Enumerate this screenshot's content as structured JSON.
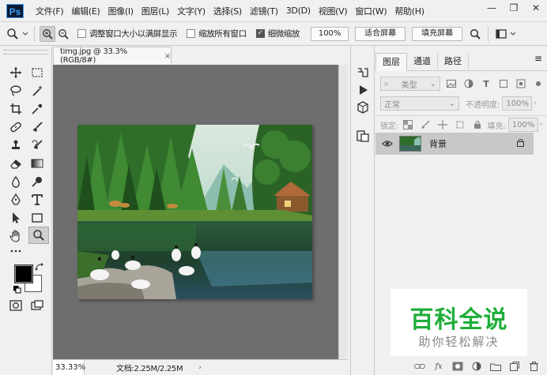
{
  "app": {
    "logo": "Ps"
  },
  "menu": [
    "文件(F)",
    "编辑(E)",
    "图像(I)",
    "图层(L)",
    "文字(Y)",
    "选择(S)",
    "滤镜(T)",
    "3D(D)",
    "视图(V)",
    "窗口(W)",
    "帮助(H)"
  ],
  "window_controls": {
    "minimize": "—",
    "restore": "❐",
    "close": "✕"
  },
  "options": {
    "resize_windows": {
      "label": "调整窗口大小以满屏显示",
      "checked": false
    },
    "zoom_all": {
      "label": "缩放所有窗口",
      "checked": false
    },
    "scrubby_zoom": {
      "label": "细微缩放",
      "checked": true
    },
    "btn_100": "100%",
    "btn_fit": "适合屏幕",
    "btn_fill": "填充屏幕"
  },
  "document": {
    "tab_title": "timg.jpg @ 33.3%(RGB/8#)",
    "tab_close": "×",
    "zoom": "33.33%",
    "info": "文档:2.25M/2.25M",
    "arrow": "›"
  },
  "layers_panel": {
    "tabs": [
      "图层",
      "通道",
      "路径"
    ],
    "filter_kind": "类型",
    "blend_mode": "正常",
    "opacity_label": "不透明度:",
    "opacity_value": "100%",
    "lock_label": "锁定:",
    "fill_label": "填充:",
    "fill_value": "100%",
    "layer_name": "背景"
  },
  "watermark": {
    "title": "百科全说",
    "subtitle": "助你轻松解决"
  },
  "colors": {
    "foreground": "#000000",
    "background": "#ffffff",
    "canvas_bg": "#6e6e6e",
    "watermark_green": "#1fae3b"
  }
}
